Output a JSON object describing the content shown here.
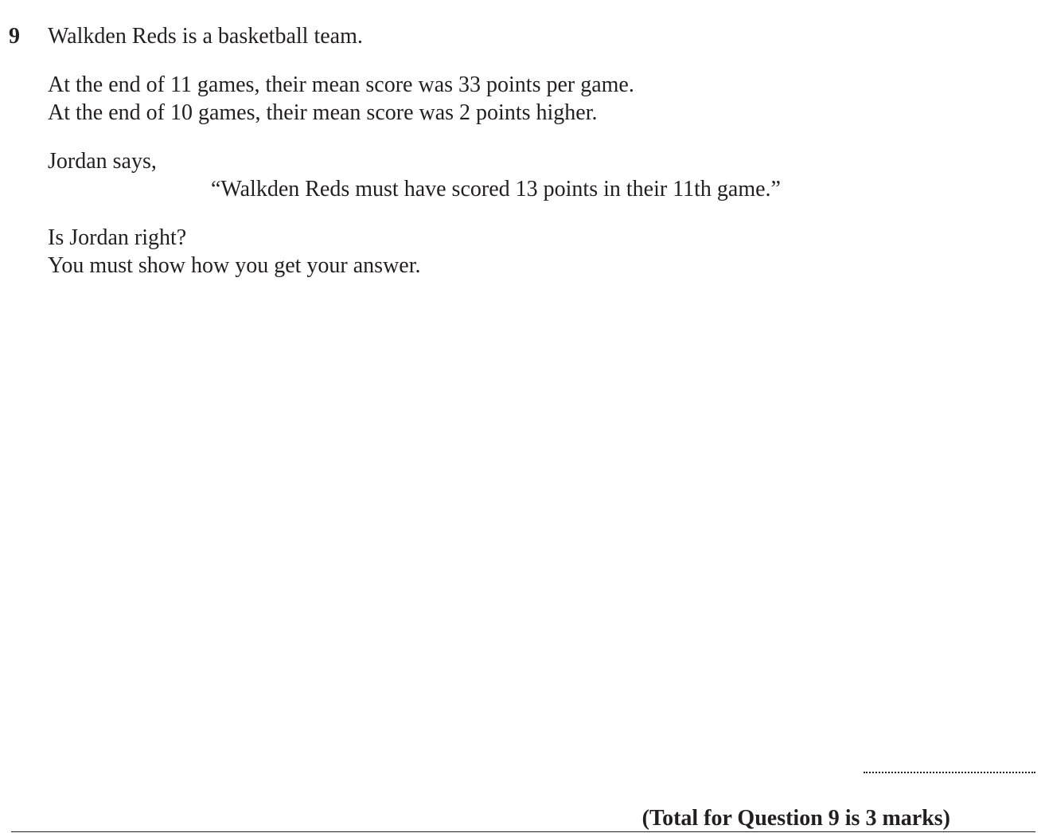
{
  "question": {
    "number": "9",
    "intro": "Walkden Reds is a basketball team.",
    "fact_1": "At the end of 11 games, their mean score was 33 points per game.",
    "fact_2": "At the end of 10 games, their mean score was 2 points higher.",
    "speaker_line": "Jordan says,",
    "quote": "“Walkden Reds must have scored 13 points in their 11th game.”",
    "prompt_1": "Is Jordan right?",
    "prompt_2": "You must show how you get your answer.",
    "total": "(Total for Question 9 is 3 marks)"
  }
}
